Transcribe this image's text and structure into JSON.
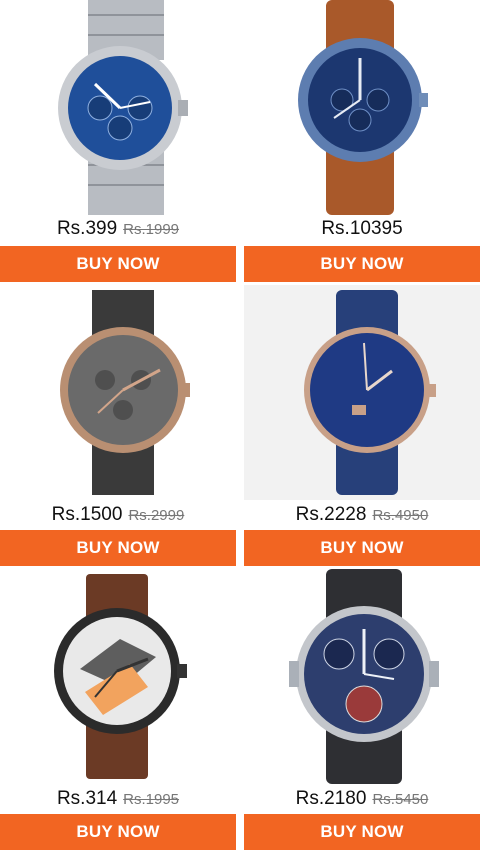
{
  "products": [
    {
      "price": "Rs.399",
      "mrp": "Rs.1999",
      "button": "BUY NOW",
      "icon": "watch-image-silver-blue-chronograph",
      "colors": {
        "strap": "#b8bcc2",
        "dial": "#1f4f9a",
        "case": "#c9ccd1"
      }
    },
    {
      "price": "Rs.10395",
      "mrp": "",
      "button": "BUY NOW",
      "icon": "watch-image-fossil-blue-brown-leather",
      "colors": {
        "strap": "#a9592a",
        "dial": "#1c3770",
        "case": "#5d7db0"
      }
    },
    {
      "price": "Rs.1500",
      "mrp": "Rs.2999",
      "button": "BUY NOW",
      "icon": "watch-image-gunmetal-mesh",
      "colors": {
        "strap": "#3a3a3a",
        "dial": "#6a6a6a",
        "case": "#b98f72"
      }
    },
    {
      "price": "Rs.2228",
      "mrp": "Rs.4950",
      "button": "BUY NOW",
      "icon": "watch-image-daniel-klein-blue-mesh",
      "colors": {
        "strap": "#27407a",
        "dial": "#1f3a84",
        "case": "#c8a088"
      }
    },
    {
      "price": "Rs.314",
      "mrp": "Rs.1995",
      "button": "BUY NOW",
      "icon": "watch-image-brown-leather-white-dial",
      "colors": {
        "strap": "#6b3a25",
        "dial": "#e9e9e9",
        "case": "#2b2b2b"
      }
    },
    {
      "price": "Rs.2180",
      "mrp": "Rs.5450",
      "button": "BUY NOW",
      "icon": "watch-image-daniel-klein-dual-time",
      "colors": {
        "strap": "#2e2f33",
        "dial": "#2d3e6e",
        "case": "#c3c6cb"
      }
    }
  ],
  "accent": "#f26522"
}
